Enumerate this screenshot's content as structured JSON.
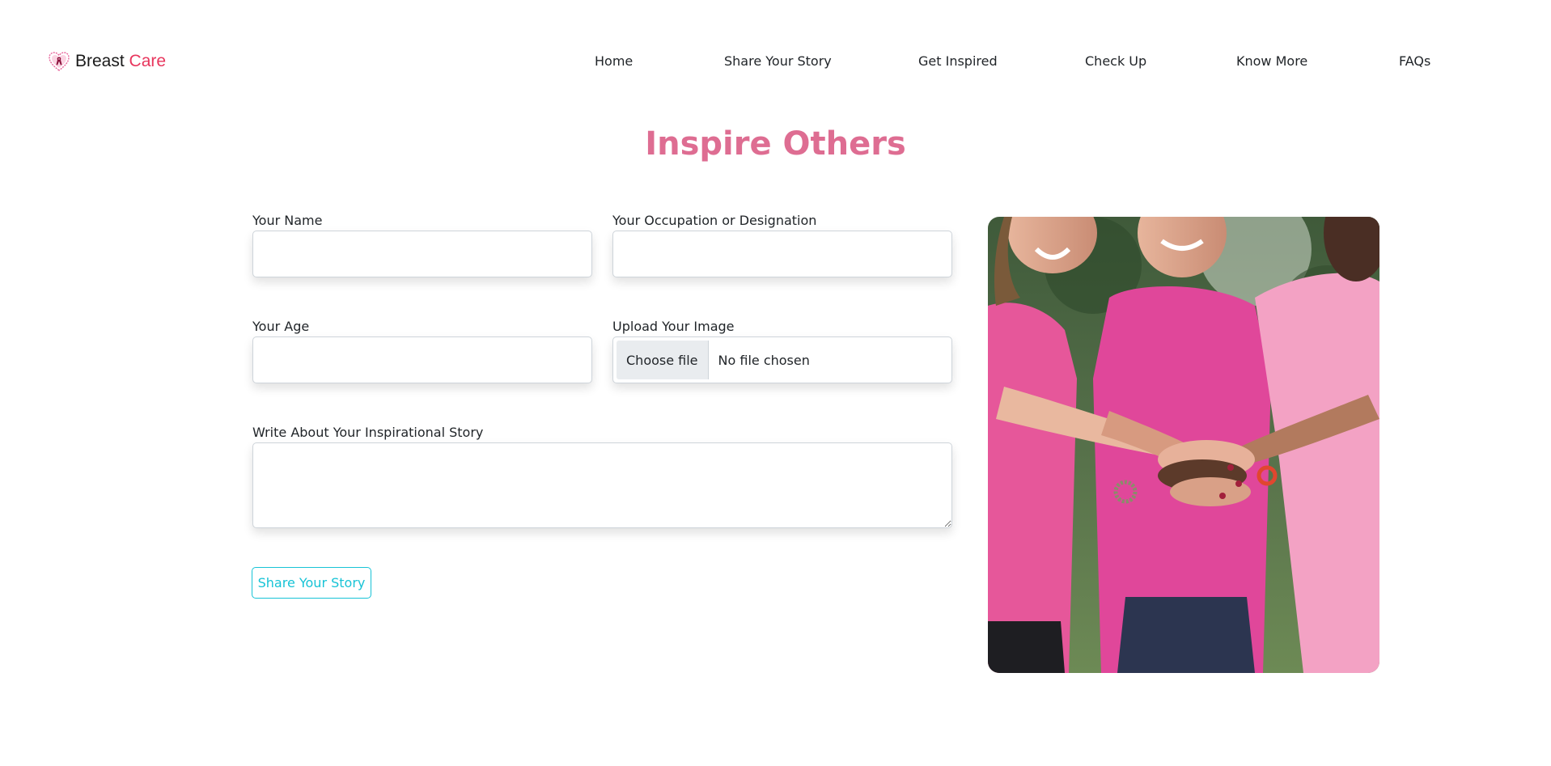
{
  "brand": {
    "name_part1": "Breast",
    "name_part2": "Care",
    "accent_color": "#e8365d",
    "icon": "heart-ribbon-icon"
  },
  "nav": {
    "items": [
      {
        "label": "Home"
      },
      {
        "label": "Share Your Story"
      },
      {
        "label": "Get Inspired"
      },
      {
        "label": "Check Up"
      },
      {
        "label": "Know More"
      },
      {
        "label": "FAQs"
      }
    ]
  },
  "page": {
    "title": "Inspire Others",
    "title_color": "#de6d92"
  },
  "form": {
    "name": {
      "label": "Your Name",
      "value": ""
    },
    "occupation": {
      "label": "Your Occupation or Designation",
      "value": ""
    },
    "age": {
      "label": "Your Age",
      "value": ""
    },
    "image": {
      "label": "Upload Your Image",
      "button_label": "Choose file",
      "status": "No file chosen"
    },
    "story": {
      "label": "Write About Your Inspirational Story",
      "value": ""
    },
    "submit_label": "Share Your Story",
    "submit_color": "#17c3d6"
  },
  "hero_image": {
    "icon": "photo-women-hands-together"
  }
}
